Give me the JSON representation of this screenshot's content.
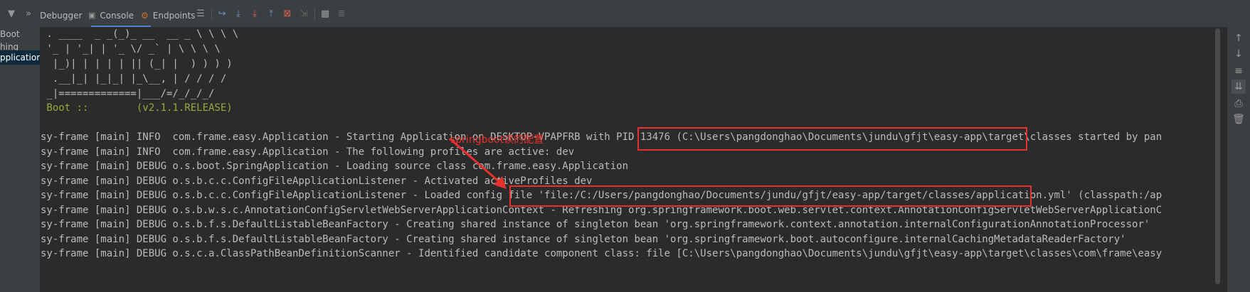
{
  "toolbar": {
    "debugger_label": "Debugger",
    "console_label": "Console",
    "endpoints_label": "Endpoints"
  },
  "sidebar": {
    "items": [
      {
        "label": "Boot"
      },
      {
        "label": "hing"
      },
      {
        "label": "pplication"
      }
    ]
  },
  "console": {
    "lines": [
      " . ____  _ _(_)_ __  __ _ \\ \\ \\ \\",
      " '_ | '_| | '_ \\/ _` | \\ \\ \\ \\",
      "  |_)| | | | | || (_| |  ) ) ) )",
      "  .__|_| |_|_| |_\\__, | / / / /",
      " _|=============|___/=/_/_/_/",
      " Boot ::        (v2.1.1.RELEASE)",
      "",
      "sy-frame [main] INFO  com.frame.easy.Application - Starting Application on DESKTOP-VPAPFRB with PID 13476 (C:\\Users\\pangdonghao\\Documents\\jundu\\gfjt\\easy-app\\target\\classes started by pan",
      "sy-frame [main] INFO  com.frame.easy.Application - The following profiles are active: dev",
      "sy-frame [main] DEBUG o.s.boot.SpringApplication - Loading source class com.frame.easy.Application",
      "sy-frame [main] DEBUG o.s.b.c.c.ConfigFileApplicationListener - Activated activeProfiles dev",
      "sy-frame [main] DEBUG o.s.b.c.c.ConfigFileApplicationListener - Loaded config file 'file:/C:/Users/pangdonghao/Documents/jundu/gfjt/easy-app/target/classes/application.yml' (classpath:/ap",
      "sy-frame [main] DEBUG o.s.b.w.s.c.AnnotationConfigServletWebServerApplicationContext - Refreshing org.springframework.boot.web.servlet.context.AnnotationConfigServletWebServerApplicationC",
      "sy-frame [main] DEBUG o.s.b.f.s.DefaultListableBeanFactory - Creating shared instance of singleton bean 'org.springframework.context.annotation.internalConfigurationAnnotationProcessor'",
      "sy-frame [main] DEBUG o.s.b.f.s.DefaultListableBeanFactory - Creating shared instance of singleton bean 'org.springframework.boot.autoconfigure.internalCachingMetadataReaderFactory'",
      "sy-frame [main] DEBUG o.s.c.a.ClassPathBeanDefinitionScanner - Identified candidate component class: file [C:\\Users\\pangdonghao\\Documents\\jundu\\gfjt\\easy-app\\target\\classes\\com\\frame\\easy"
    ]
  },
  "annotation": {
    "label": "springboot读的配置",
    "color": "#e8312f"
  },
  "colors": {
    "background": "#2b2b2b",
    "text": "#bbbbbb",
    "banner_version": "#9aa83a",
    "accent": "#4a88c7"
  }
}
